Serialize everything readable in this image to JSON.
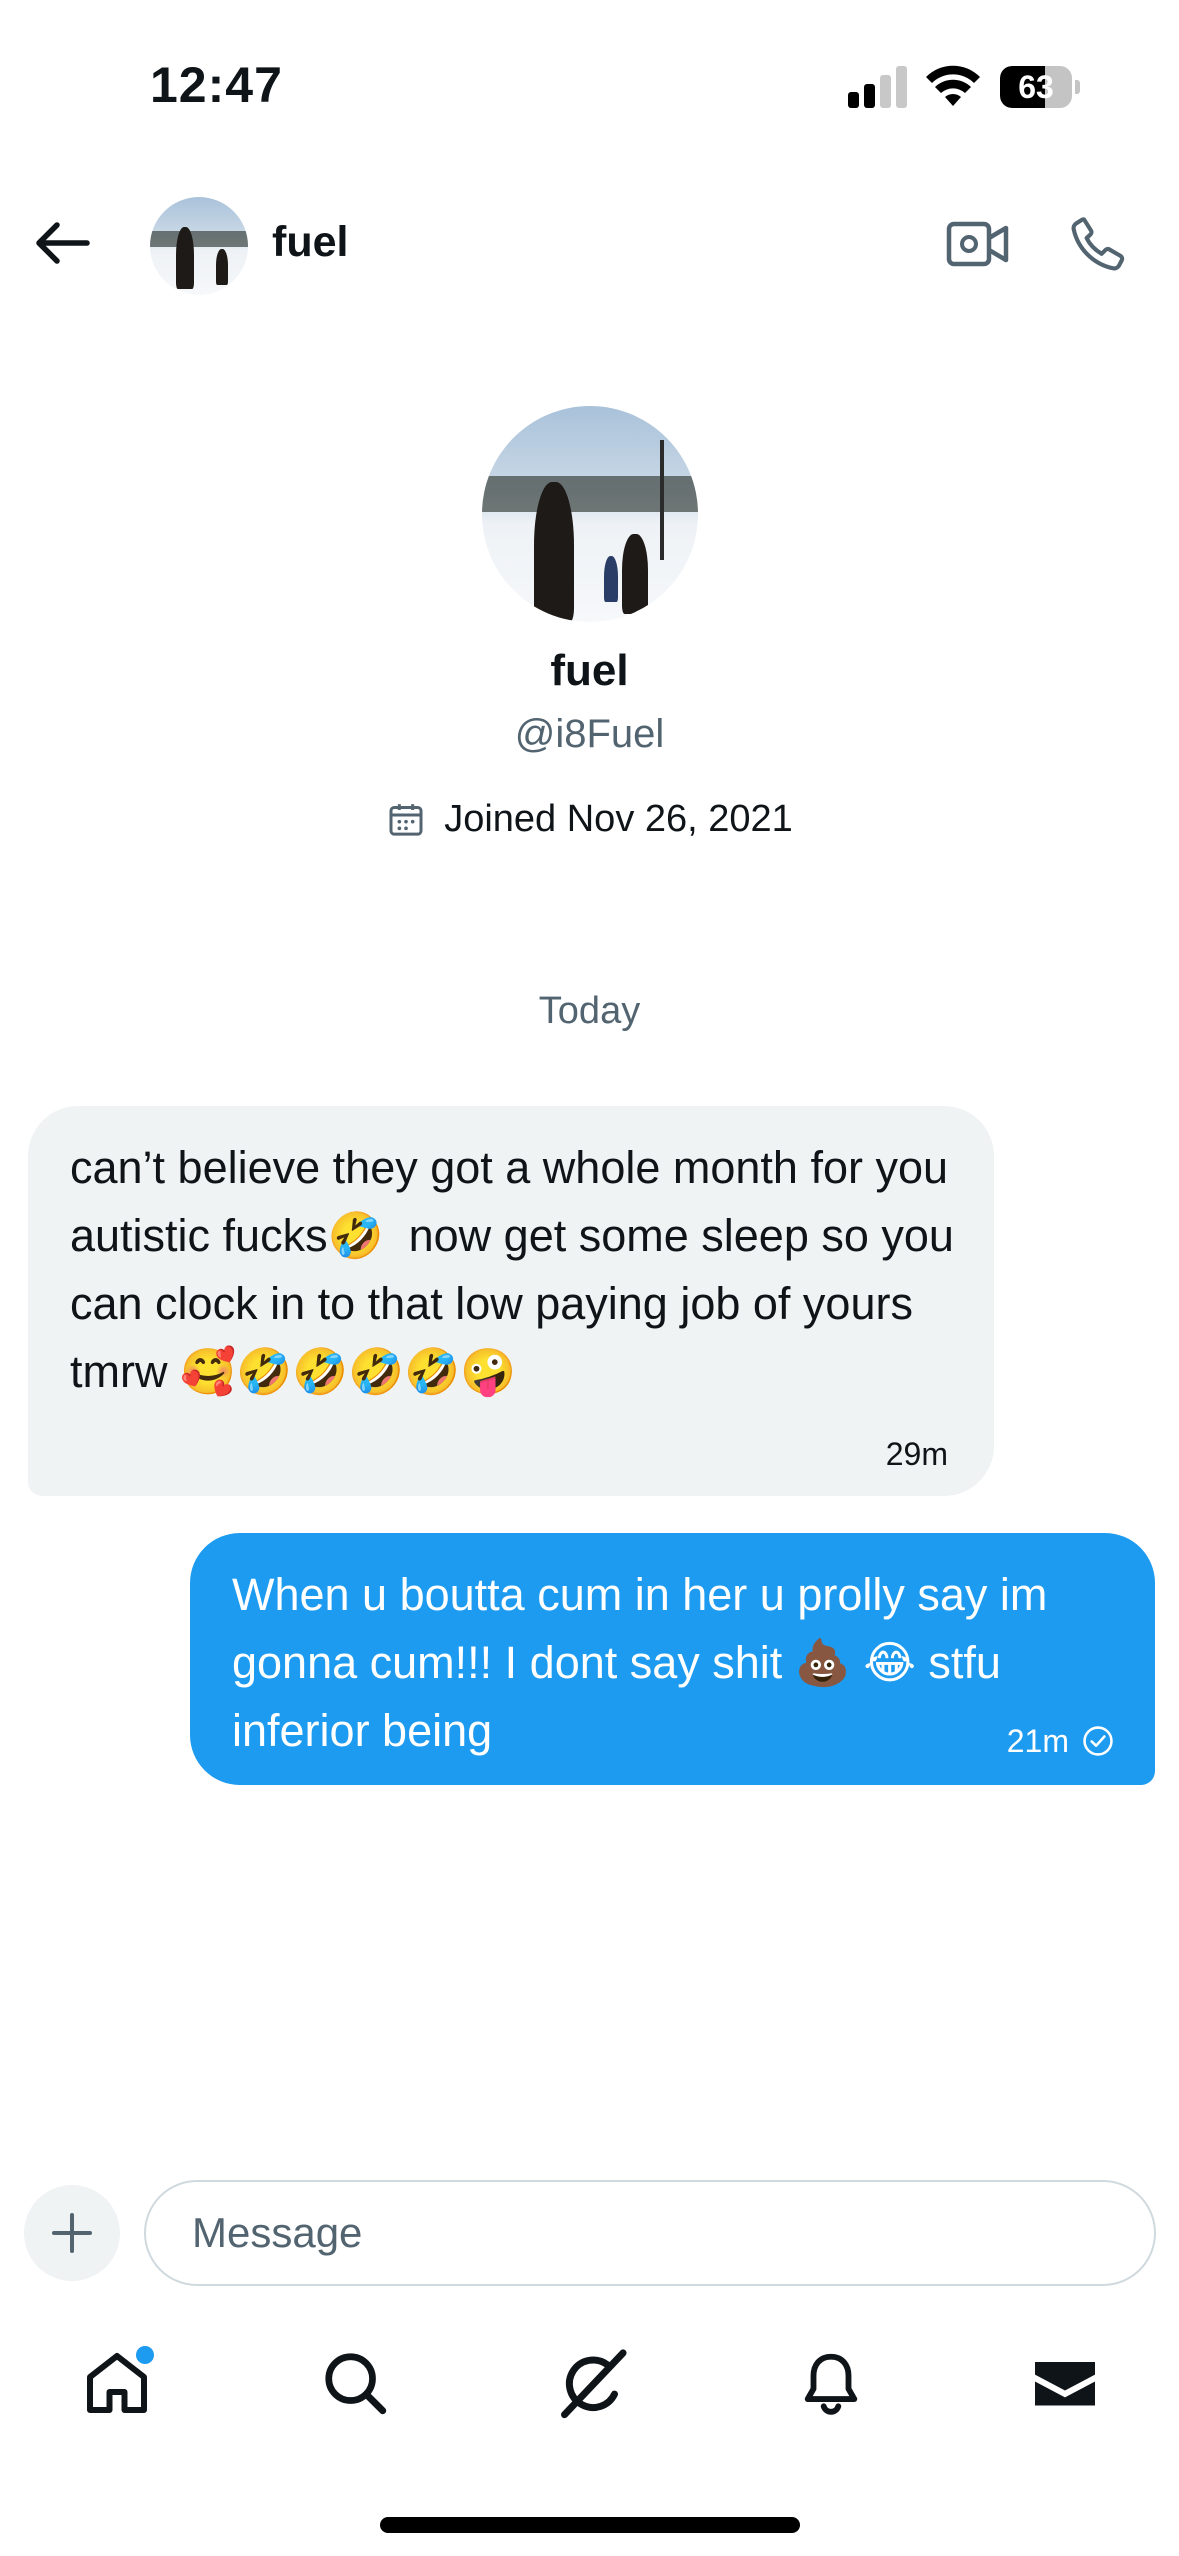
{
  "status_bar": {
    "time": "12:47",
    "battery_level": "63",
    "battery_fraction": 0.63
  },
  "header": {
    "name": "fuel",
    "icons": [
      "back-arrow-icon",
      "video-camera-icon",
      "phone-icon"
    ]
  },
  "profile": {
    "name": "fuel",
    "handle": "@i8Fuel",
    "joined": "Joined Nov 26, 2021"
  },
  "conversation": {
    "date_divider": "Today",
    "messages": [
      {
        "direction": "incoming",
        "text": "can’t believe they got a whole month for you autistic fucks🤣  now get some sleep so you can clock in to that low paying job of yours tmrw 🥰🤣🤣🤣🤣🤪",
        "time": "29m"
      },
      {
        "direction": "outgoing",
        "text": "When u boutta cum in her u prolly say im gonna cum!!! I dont say shit 💩 😂 stfu inferior being",
        "time": "21m",
        "status": "sent"
      }
    ]
  },
  "composer": {
    "placeholder": "Message"
  },
  "tab_bar": {
    "items": [
      "home",
      "search",
      "grok",
      "notifications",
      "messages"
    ],
    "active": "messages",
    "home_has_badge": true
  },
  "colors": {
    "accent": "#1d9bf0",
    "incoming_bubble": "#eff3f4",
    "secondary_text": "#536471"
  }
}
